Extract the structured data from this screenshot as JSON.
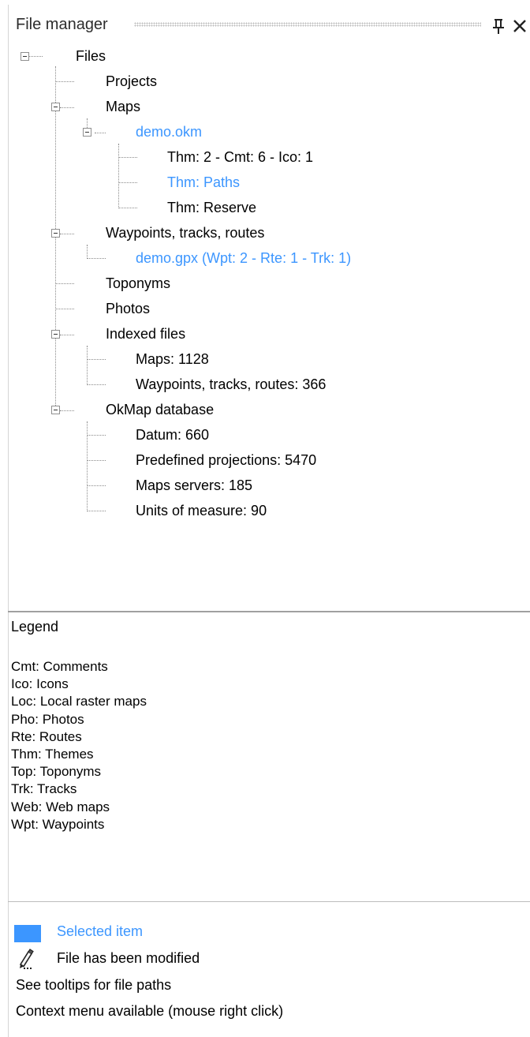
{
  "header": {
    "title": "File manager"
  },
  "tree": {
    "root": "Files",
    "projects": "Projects",
    "maps": "Maps",
    "map_file": "demo.okm",
    "map_themes": [
      "Thm: 2 - Cmt: 6 - Ico: 1",
      "Thm: Paths",
      "Thm: Reserve"
    ],
    "waypoints": "Waypoints, tracks, routes",
    "gpx_file": "demo.gpx (Wpt: 2 - Rte: 1 - Trk: 1)",
    "toponyms": "Toponyms",
    "photos": "Photos",
    "indexed": "Indexed files",
    "indexed_items": [
      "Maps: 1128",
      "Waypoints, tracks, routes: 366"
    ],
    "database": "OkMap database",
    "database_items": [
      "Datum: 660",
      "Predefined projections: 5470",
      "Maps servers: 185",
      "Units of measure: 90"
    ]
  },
  "legend": {
    "title": "Legend",
    "items": [
      "Cmt: Comments",
      "Ico: Icons",
      "Loc: Local raster maps",
      "Pho: Photos",
      "Rte: Routes",
      "Thm: Themes",
      "Top: Toponyms",
      "Trk: Tracks",
      "Web: Web maps",
      "Wpt: Waypoints"
    ]
  },
  "notes": {
    "selected_item": "Selected item",
    "modified": "File has been modified",
    "tooltips": "See tooltips for file paths",
    "context_menu": "Context menu available (mouse right click)"
  },
  "colors": {
    "selected": "#3c96ff",
    "separator": "#a0a0a0"
  },
  "icons": [
    "pin-icon",
    "close-icon",
    "collapse-icon",
    "pencil-icon"
  ]
}
